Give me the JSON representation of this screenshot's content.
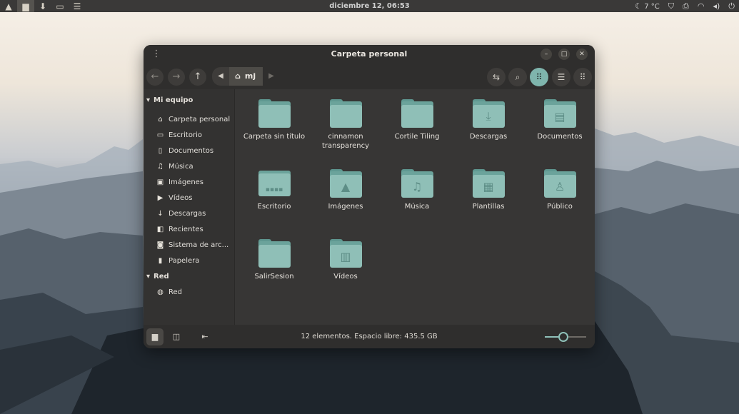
{
  "topbar": {
    "clock": "diciembre 12, 06:53",
    "weather": "7 °C",
    "launchers": [
      "menu-icon",
      "files-icon",
      "downloads-icon",
      "terminal-icon",
      "settings-icon"
    ]
  },
  "window": {
    "title": "Carpeta personal",
    "breadcrumb": "mj",
    "statusbar": "12 elementos. Espacio libre: 435.5 GB",
    "zoom_level": 0.45,
    "accent": "#7fb5ad",
    "folder_color": "#8fbfb7"
  },
  "sidebar": {
    "sections": [
      {
        "title": "Mi equipo",
        "items": [
          {
            "label": "Carpeta personal",
            "icon": "home-icon"
          },
          {
            "label": "Escritorio",
            "icon": "desktop-icon"
          },
          {
            "label": "Documentos",
            "icon": "document-icon"
          },
          {
            "label": "Música",
            "icon": "music-icon"
          },
          {
            "label": "Imágenes",
            "icon": "image-icon"
          },
          {
            "label": "Vídeos",
            "icon": "video-icon"
          },
          {
            "label": "Descargas",
            "icon": "download-icon"
          },
          {
            "label": "Recientes",
            "icon": "recent-icon"
          },
          {
            "label": "Sistema de arc...",
            "icon": "drive-icon"
          },
          {
            "label": "Papelera",
            "icon": "trash-icon"
          }
        ]
      },
      {
        "title": "Red",
        "items": [
          {
            "label": "Red",
            "icon": "network-icon"
          }
        ]
      }
    ]
  },
  "files": [
    {
      "label": "Carpeta sin título",
      "emblem": ""
    },
    {
      "label": "cinnamon transparency",
      "emblem": ""
    },
    {
      "label": "Cortile Tiling",
      "emblem": ""
    },
    {
      "label": "Descargas",
      "emblem": "download-icon"
    },
    {
      "label": "Documentos",
      "emblem": "document-icon"
    },
    {
      "label": "Escritorio",
      "emblem": "desktop-icon"
    },
    {
      "label": "Imágenes",
      "emblem": "image-icon"
    },
    {
      "label": "Música",
      "emblem": "music-icon"
    },
    {
      "label": "Plantillas",
      "emblem": "template-icon"
    },
    {
      "label": "Público",
      "emblem": "user-icon"
    },
    {
      "label": "SalirSesion",
      "emblem": ""
    },
    {
      "label": "Vídeos",
      "emblem": "film-icon"
    }
  ]
}
